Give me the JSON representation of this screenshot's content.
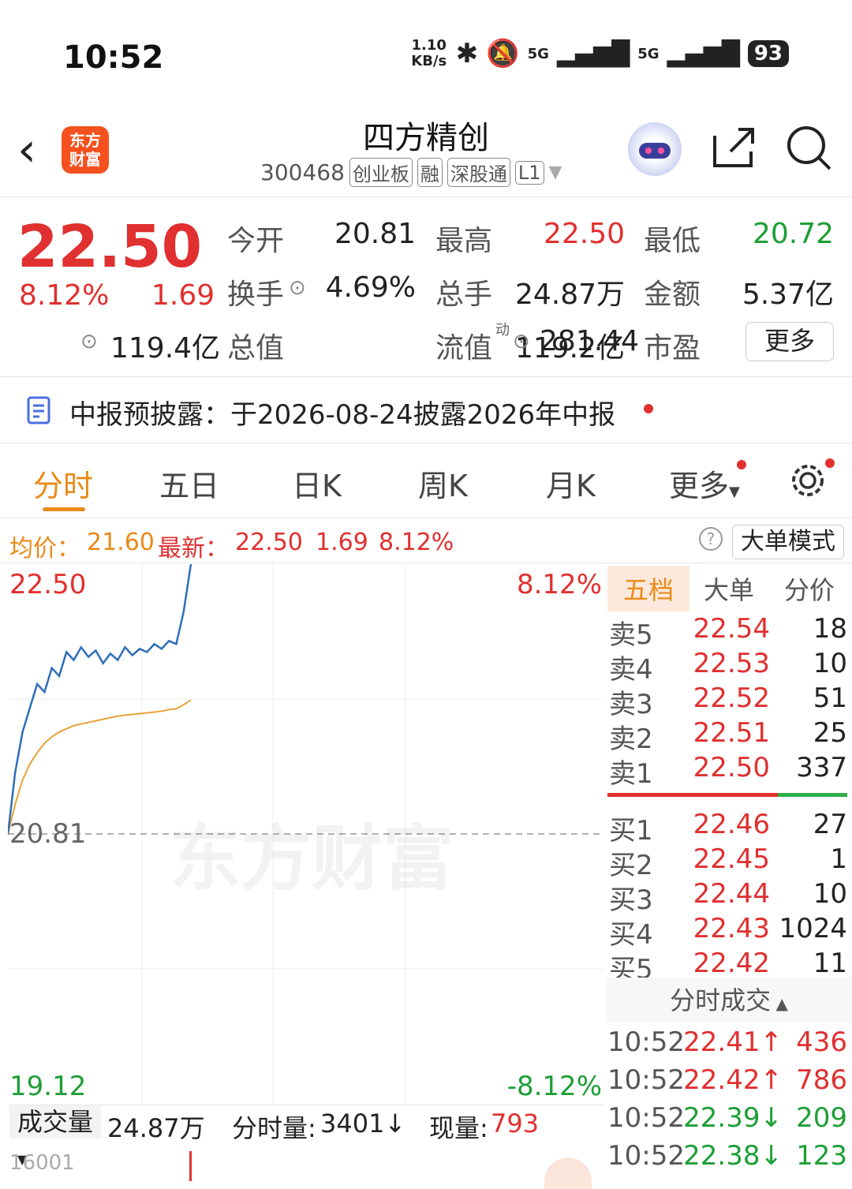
{
  "status": {
    "time": "10:52",
    "net_speed": "1.10 KB/s",
    "signal1": "5G",
    "signal2": "5G",
    "battery": "93"
  },
  "header": {
    "stock_name": "四方精创",
    "code": "300468",
    "tags": [
      "创业板",
      "融",
      "深股通",
      "L1"
    ],
    "logo_text": "东方财富"
  },
  "quote": {
    "price": "22.50",
    "pct": "8.12%",
    "change": "1.69",
    "rows": [
      [
        {
          "label": "今开",
          "value": "20.81",
          "color": "#222"
        },
        {
          "label": "最高",
          "value": "22.50",
          "color": "#e0302f"
        },
        {
          "label": "最低",
          "value": "20.72",
          "color": "#1e9e36"
        }
      ],
      [
        {
          "label": "换手",
          "value": "4.69%",
          "color": "#222"
        },
        {
          "label": "总手",
          "value": "24.87万",
          "color": "#222"
        },
        {
          "label": "金额",
          "value": "5.37亿",
          "color": "#222"
        }
      ],
      [
        {
          "label": "总值",
          "value": "119.4亿",
          "color": "#222"
        },
        {
          "label": "流值",
          "value": "119.2亿",
          "color": "#222"
        },
        {
          "label": "市盈",
          "value": "281.44",
          "color": "#222"
        }
      ]
    ],
    "pe_superscript": "动",
    "more": "更多"
  },
  "notice": {
    "text": "中报预披露：于2026-08-24披露2026年中报"
  },
  "tabs": [
    "分时",
    "五日",
    "日K",
    "周K",
    "月K",
    "更多"
  ],
  "avg": {
    "avg_label": "均价：",
    "avg_value": "21.60",
    "latest_label": "最新：",
    "latest_value": "22.50",
    "change": "1.69",
    "pct": "8.12%",
    "mode_button": "大单模式"
  },
  "chart": {
    "y_top": "22.50",
    "y_mid": "20.81",
    "y_bottom": "19.12",
    "pct_top": "8.12%",
    "pct_bottom": "-8.12%",
    "watermark": "东方财富"
  },
  "chart_data": {
    "type": "line",
    "ylim": [
      19.12,
      22.5
    ],
    "series": [
      {
        "values": [
          20.81,
          21.2,
          21.45,
          21.6,
          21.75,
          21.7,
          21.85,
          21.8,
          21.95,
          21.9,
          21.98,
          21.92,
          21.96,
          21.88,
          21.94,
          21.9,
          21.98,
          21.93,
          21.97,
          21.95,
          22.0,
          21.97,
          22.02,
          22.0,
          22.2,
          22.5
        ]
      },
      {
        "values": [
          20.81,
          21.0,
          21.15,
          21.25,
          21.32,
          21.38,
          21.42,
          21.45,
          21.47,
          21.49,
          21.5,
          21.51,
          21.52,
          21.53,
          21.54,
          21.55,
          21.555,
          21.56,
          21.565,
          21.57,
          21.575,
          21.58,
          21.59,
          21.595,
          21.62,
          21.65
        ]
      }
    ]
  },
  "orderbook": {
    "tabs": [
      "五档",
      "大单",
      "分价"
    ],
    "asks": [
      {
        "label": "卖5",
        "price": "22.54",
        "vol": "18"
      },
      {
        "label": "卖4",
        "price": "22.53",
        "vol": "10"
      },
      {
        "label": "卖3",
        "price": "22.52",
        "vol": "51"
      },
      {
        "label": "卖2",
        "price": "22.51",
        "vol": "25"
      },
      {
        "label": "卖1",
        "price": "22.50",
        "vol": "337"
      }
    ],
    "bids": [
      {
        "label": "买1",
        "price": "22.46",
        "vol": "27"
      },
      {
        "label": "买2",
        "price": "22.45",
        "vol": "1"
      },
      {
        "label": "买3",
        "price": "22.44",
        "vol": "10"
      },
      {
        "label": "买4",
        "price": "22.43",
        "vol": "1024"
      },
      {
        "label": "买5",
        "price": "22.42",
        "vol": "11"
      }
    ],
    "ticks_title": "分时成交",
    "ticks": [
      {
        "time": "10:52",
        "price": "22.41↑",
        "vol": "436",
        "color": "#e0302f"
      },
      {
        "time": "10:52",
        "price": "22.42↑",
        "vol": "786",
        "color": "#e0302f"
      },
      {
        "time": "10:52",
        "price": "22.39↓",
        "vol": "209",
        "color": "#1e9e36"
      },
      {
        "time": "10:52",
        "price": "22.38↓",
        "vol": "123",
        "color": "#1e9e36"
      }
    ]
  },
  "volume": {
    "label": "成交量",
    "total": "24.87万",
    "tick_label": "分时量:",
    "tick_value": "3401↓",
    "now_label": "现量:",
    "now_value": "793",
    "axis": "16001"
  }
}
